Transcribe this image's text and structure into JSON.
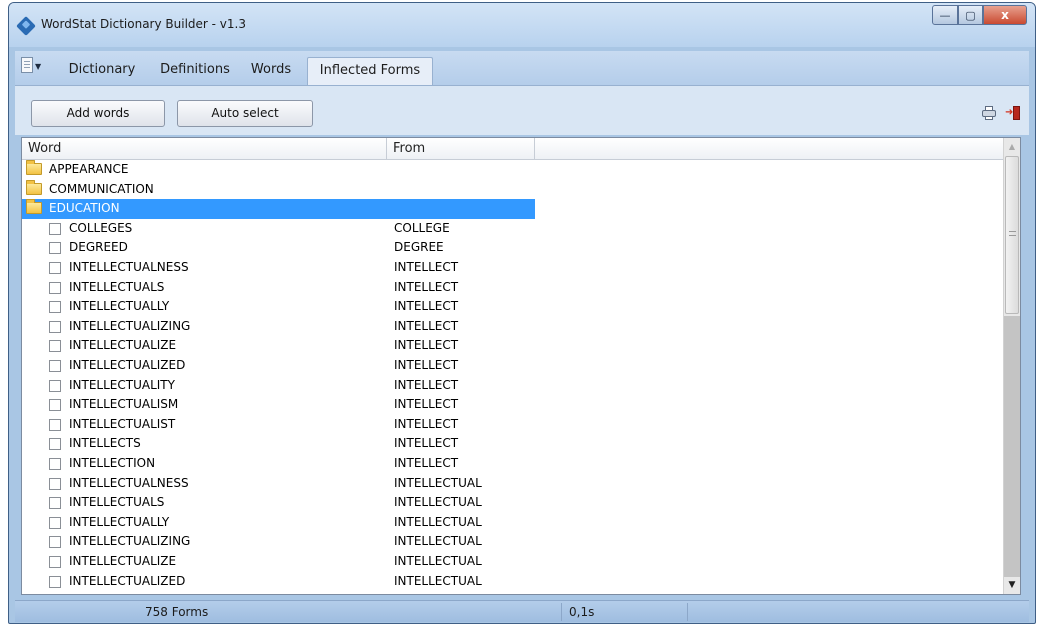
{
  "window": {
    "title": "WordStat Dictionary Builder - v1.3",
    "controls": {
      "minimize": "—",
      "maximize": "▢",
      "close": "x"
    }
  },
  "tabs": [
    {
      "label": "Dictionary"
    },
    {
      "label": "Definitions"
    },
    {
      "label": "Words"
    },
    {
      "label": "Inflected Forms",
      "active": true
    }
  ],
  "toolbar": {
    "add_words_label": "Add words",
    "auto_select_label": "Auto select",
    "icons": [
      "printer-icon",
      "exit-icon"
    ]
  },
  "list": {
    "columns": [
      "Word",
      "From"
    ],
    "groups": [
      {
        "label": "APPEARANCE"
      },
      {
        "label": "COMMUNICATION"
      },
      {
        "label": "EDUCATION",
        "selected": true
      }
    ],
    "rows": [
      {
        "word": "COLLEGES",
        "from": "COLLEGE",
        "checked": false
      },
      {
        "word": "DEGREED",
        "from": "DEGREE",
        "checked": false
      },
      {
        "word": "INTELLECTUALNESS",
        "from": "INTELLECT",
        "checked": false
      },
      {
        "word": "INTELLECTUALS",
        "from": "INTELLECT",
        "checked": false
      },
      {
        "word": "INTELLECTUALLY",
        "from": "INTELLECT",
        "checked": false
      },
      {
        "word": "INTELLECTUALIZING",
        "from": "INTELLECT",
        "checked": false
      },
      {
        "word": "INTELLECTUALIZE",
        "from": "INTELLECT",
        "checked": false
      },
      {
        "word": "INTELLECTUALIZED",
        "from": "INTELLECT",
        "checked": false
      },
      {
        "word": "INTELLECTUALITY",
        "from": "INTELLECT",
        "checked": false
      },
      {
        "word": "INTELLECTUALISM",
        "from": "INTELLECT",
        "checked": false
      },
      {
        "word": "INTELLECTUALIST",
        "from": "INTELLECT",
        "checked": false
      },
      {
        "word": "INTELLECTS",
        "from": "INTELLECT",
        "checked": false
      },
      {
        "word": "INTELLECTION",
        "from": "INTELLECT",
        "checked": false
      },
      {
        "word": "INTELLECTUALNESS",
        "from": "INTELLECTUAL",
        "checked": false
      },
      {
        "word": "INTELLECTUALS",
        "from": "INTELLECTUAL",
        "checked": false
      },
      {
        "word": "INTELLECTUALLY",
        "from": "INTELLECTUAL",
        "checked": false
      },
      {
        "word": "INTELLECTUALIZING",
        "from": "INTELLECTUAL",
        "checked": false
      },
      {
        "word": "INTELLECTUALIZE",
        "from": "INTELLECTUAL",
        "checked": false
      },
      {
        "word": "INTELLECTUALIZED",
        "from": "INTELLECTUAL",
        "checked": false
      }
    ]
  },
  "status": {
    "forms": "758 Forms",
    "time": "0,1s"
  },
  "colors": {
    "selection": "#3399ff",
    "window_frame": "#a9c6e4",
    "status_bar": "#b4cdea"
  }
}
